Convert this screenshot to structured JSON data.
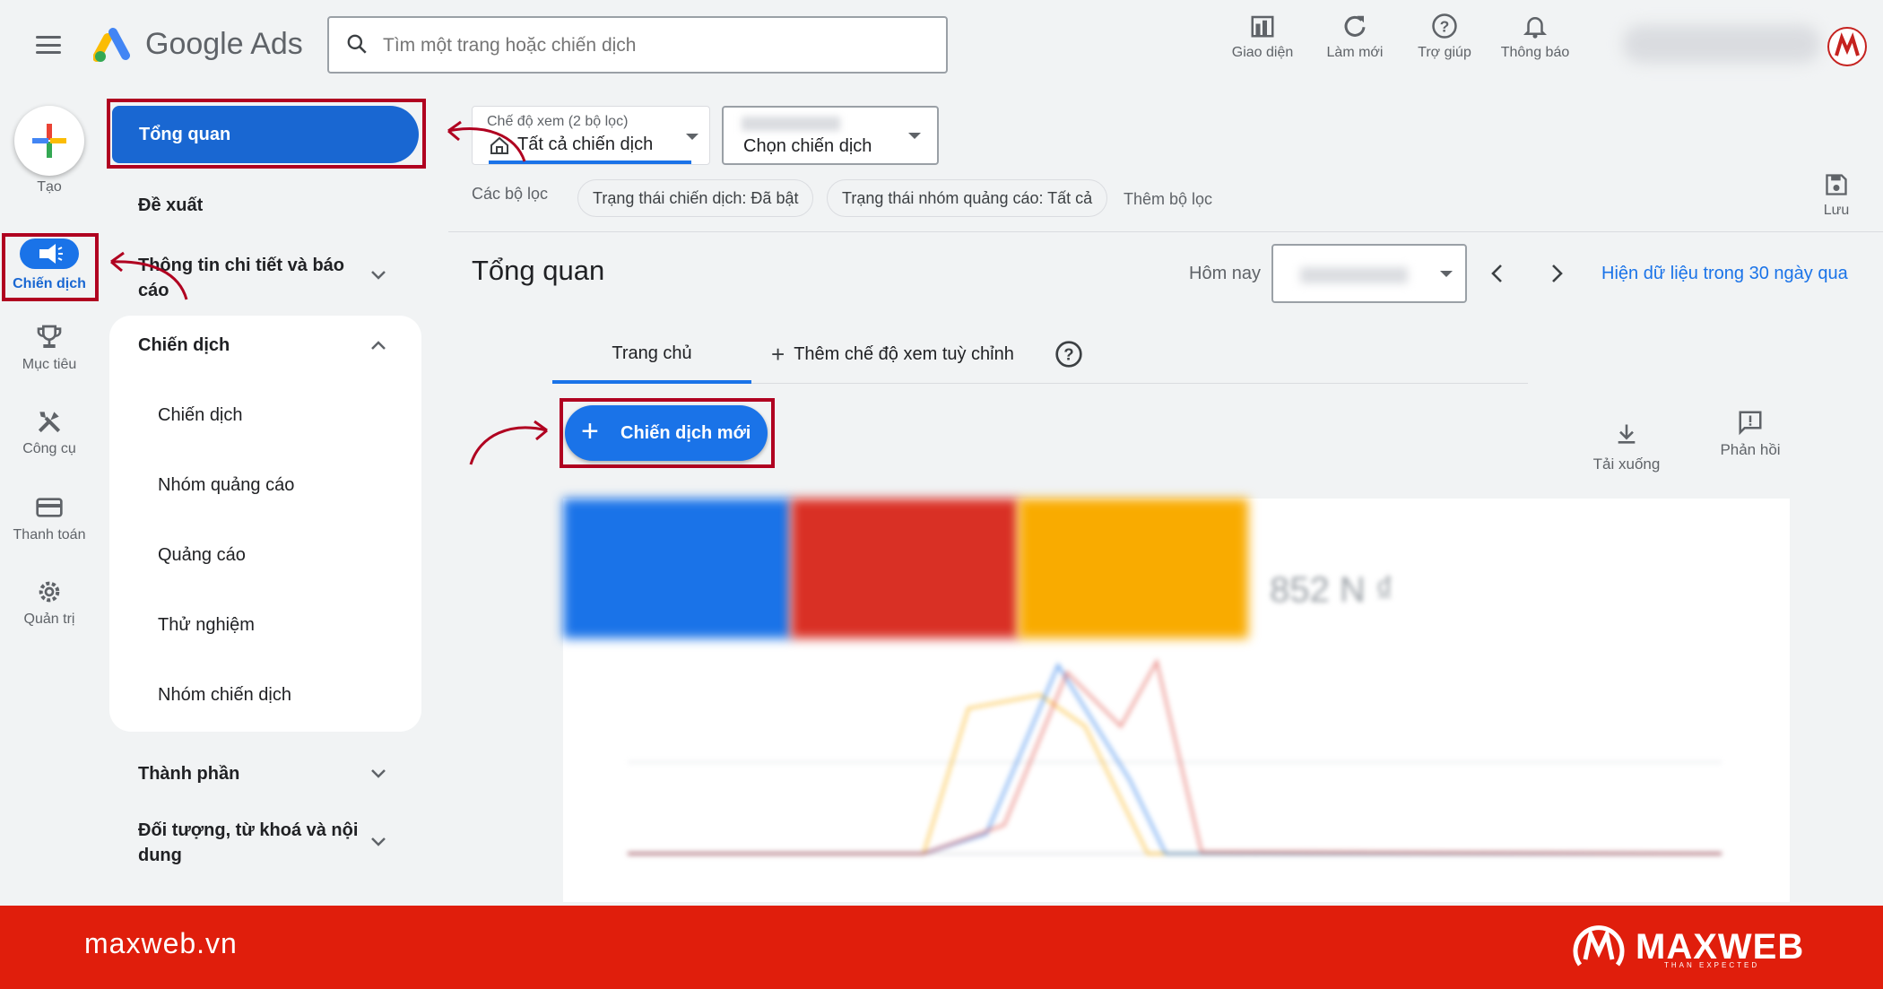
{
  "header": {
    "brand": "Google Ads",
    "search_placeholder": "Tìm một trang hoặc chiến dịch",
    "actions": [
      {
        "label": "Giao diện",
        "icon": "appearance-icon"
      },
      {
        "label": "Làm mới",
        "icon": "refresh-icon"
      },
      {
        "label": "Trợ giúp",
        "icon": "help-icon"
      },
      {
        "label": "Thông báo",
        "icon": "bell-icon"
      }
    ]
  },
  "rail": {
    "create_label": "Tạo",
    "items": [
      {
        "label": "Chiến dịch",
        "icon": "megaphone-icon"
      },
      {
        "label": "Mục tiêu",
        "icon": "trophy-icon"
      },
      {
        "label": "Công cụ",
        "icon": "tools-icon"
      },
      {
        "label": "Thanh toán",
        "icon": "credit-card-icon"
      },
      {
        "label": "Quản trị",
        "icon": "gear-icon"
      }
    ]
  },
  "sidenav": {
    "overview": "Tổng quan",
    "recommendations": "Đề xuất",
    "insights_line1": "Thông tin chi tiết và báo",
    "insights_line2": "cáo",
    "campaigns_group": "Chiến dịch",
    "campaign_items": [
      "Chiến dịch",
      "Nhóm quảng cáo",
      "Quảng cáo",
      "Thử nghiệm",
      "Nhóm chiến dịch"
    ],
    "assets": "Thành phần",
    "audiences_line1": "Đối tượng, từ khoá và nội",
    "audiences_line2": "dung"
  },
  "filters": {
    "view_mode_label": "Chế độ xem (2 bộ lọc)",
    "view_mode_value": "Tất cả chiến dịch",
    "campaign_select": "Chọn chiến dịch",
    "filters_label": "Các bộ lọc",
    "chips": [
      "Trạng thái chiến dịch: Đã bật",
      "Trạng thái nhóm quảng cáo: Tất cả"
    ],
    "add_filter": "Thêm bộ lọc",
    "save": "Lưu"
  },
  "main": {
    "title": "Tổng quan",
    "date_label": "Hôm nay",
    "last30_link": "Hiện dữ liệu trong 30 ngày qua",
    "tabs": [
      "Trang chủ"
    ],
    "add_custom_view": "Thêm chế độ xem tuỳ chỉnh",
    "new_campaign": "Chiến dịch mới",
    "download": "Tải xuống",
    "feedback": "Phản hồi",
    "scorecard_value": "852 N ₫"
  },
  "footer": {
    "site": "maxweb.vn",
    "brand": "MAXWEB",
    "tagline": "THAN EXPECTED"
  },
  "colors": {
    "primary": "#1a73e8",
    "highlight_red": "#b00020",
    "footer_red": "#e01e0c",
    "score_blue": "#1a73e8",
    "score_red": "#d93025",
    "score_yellow": "#f9ab00"
  }
}
